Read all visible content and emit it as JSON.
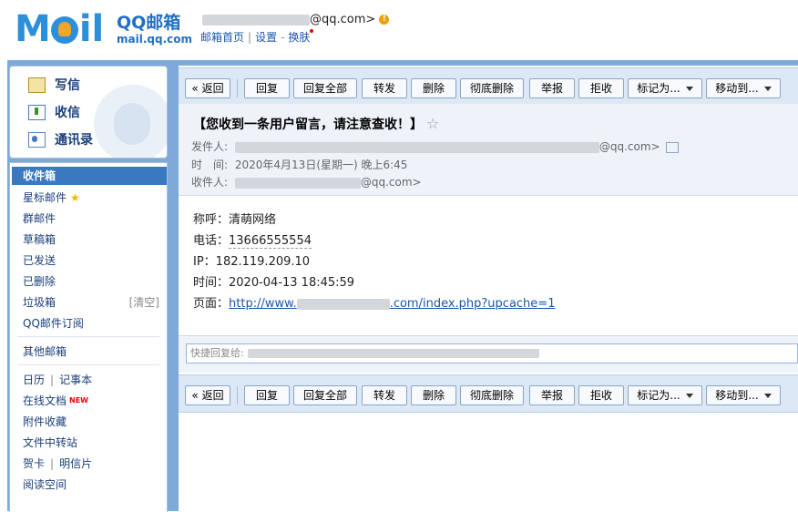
{
  "header": {
    "logo_text": "MOil",
    "brand_title": "QQ邮箱",
    "brand_sub": "mail.qq.com",
    "account_suffix": "@qq.com>",
    "links": [
      "邮箱首页",
      "设置",
      "换肤"
    ]
  },
  "quick": {
    "write": "写信",
    "receive": "收信",
    "contacts": "通讯录"
  },
  "folders": {
    "inbox": "收件箱",
    "starred": "星标邮件",
    "group": "群邮件",
    "drafts": "草稿箱",
    "sent": "已发送",
    "deleted": "已删除",
    "spam": "垃圾箱",
    "spam_clear": "[清空]",
    "subscriptions": "QQ邮件订阅",
    "other": "其他邮箱",
    "calendar": "日历",
    "notes": "记事本",
    "docs": "在线文档",
    "docs_new": "NEW",
    "attachments": "附件收藏",
    "transfer": "文件中转站",
    "cards": "贺卡",
    "postcards": "明信片",
    "reading": "阅读空间"
  },
  "toolbar": {
    "back": "« 返回",
    "reply": "回复",
    "reply_all": "回复全部",
    "forward": "转发",
    "delete": "删除",
    "delete_perm": "彻底删除",
    "report": "举报",
    "reject": "拒收",
    "mark_as": "标记为...",
    "move_to": "移动到..."
  },
  "mail": {
    "subject": "【您收到一条用户留言，请注意查收！】",
    "from_label": "发件人:",
    "from_suffix": "@qq.com>",
    "time_label": "时　间:",
    "time_value": "2020年4月13日(星期一) 晚上6:45",
    "to_label": "收件人:",
    "to_suffix": "@qq.com>",
    "body": {
      "name_line": "称呼：清萌网络",
      "phone_label": "电话：",
      "phone": "13666555554",
      "ip_line": "IP：182.119.209.10",
      "time_line": "时间：2020-04-13 18:45:59",
      "page_label": "页面：",
      "url_prefix": "http://www.",
      "url_suffix": ".com/index.php?upcache=1"
    }
  },
  "quick_reply": {
    "placeholder": "快捷回复给:"
  },
  "colors": {
    "frame_blue": "#7ea9d8",
    "toolbar_bg": "#dce8f6",
    "active_folder": "#3a78c0",
    "link": "#1a56b0"
  }
}
